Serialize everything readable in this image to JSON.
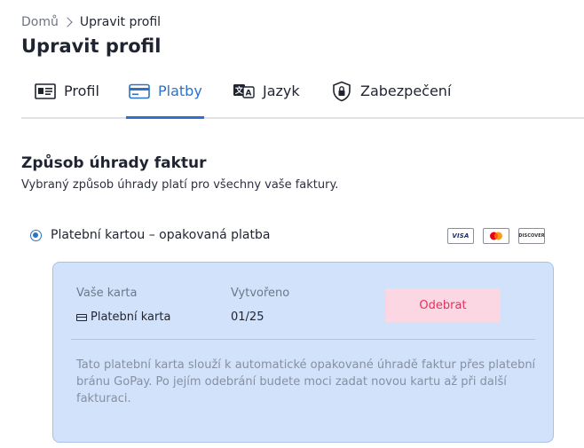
{
  "breadcrumb": {
    "home": "Domů",
    "current": "Upravit profil"
  },
  "page": {
    "title": "Upravit profil"
  },
  "tabs": [
    {
      "label": "Profil",
      "icon": "id-card-icon",
      "active": false
    },
    {
      "label": "Platby",
      "icon": "credit-card-icon",
      "active": true
    },
    {
      "label": "Jazyk",
      "icon": "translate-icon",
      "active": false
    },
    {
      "label": "Zabezpečení",
      "icon": "shield-lock-icon",
      "active": false
    }
  ],
  "payment_section": {
    "title": "Způsob úhrady faktur",
    "subtitle": "Vybraný způsob úhrady platí pro všechny vaše faktury."
  },
  "method": {
    "label": "Platební kartou – opakovaná platba",
    "selected": true,
    "logos": {
      "visa": "VISA",
      "mastercard": "mastercard-icon",
      "discover": "DISCOVER"
    }
  },
  "card": {
    "card_label": "Vaše karta",
    "card_value": "Platební karta",
    "created_label": "Vytvořeno",
    "created_value": "01/25",
    "remove_button": "Odebrat",
    "note": "Tato platební karta slouží k automatické opakované úhradě faktur přes platební bránu GoPay. Po jejím odebrání budete moci zadat novou kartu až při další fakturaci."
  },
  "colors": {
    "accent": "#2b72c8",
    "panel_background": "#d3e2fb",
    "remove_button_bg": "#fbd7e4",
    "remove_button_text": "#e0325f"
  }
}
